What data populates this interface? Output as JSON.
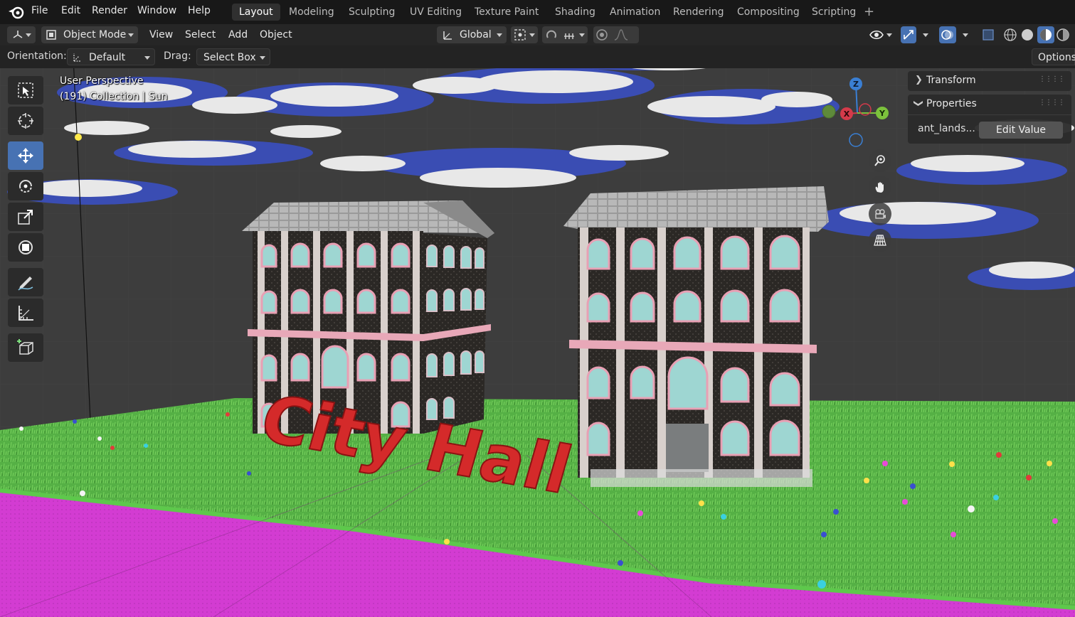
{
  "menu": [
    "File",
    "Edit",
    "Render",
    "Window",
    "Help"
  ],
  "workspaces": [
    "Layout",
    "Modeling",
    "Sculpting",
    "UV Editing",
    "Texture Paint",
    "Shading",
    "Animation",
    "Rendering",
    "Compositing",
    "Scripting"
  ],
  "active_workspace": "Layout",
  "header": {
    "mode": "Object Mode",
    "view": "View",
    "select": "Select",
    "add": "Add",
    "object": "Object",
    "transform_orientation": "Global"
  },
  "tool_settings": {
    "orientation_label": "Orientation:",
    "orientation_value": "Default",
    "drag_label": "Drag:",
    "drag_value": "Select Box",
    "options": "Options"
  },
  "viewport": {
    "view_name": "User Perspective",
    "collection_info": "(191) Collection | Sun",
    "sign_text": "City Hall"
  },
  "gizmo": {
    "x": "X",
    "y": "Y",
    "z": "Z"
  },
  "npanel": {
    "transform": "Transform",
    "properties": "Properties",
    "prop_key": "ant_lands...",
    "prop_button": "Edit Value"
  },
  "colors": {
    "accent": "#4772b3",
    "path": "#d73ad6",
    "grass": "#4aa63c",
    "sign": "#d42a2a",
    "sky": "#3a3a3a"
  }
}
